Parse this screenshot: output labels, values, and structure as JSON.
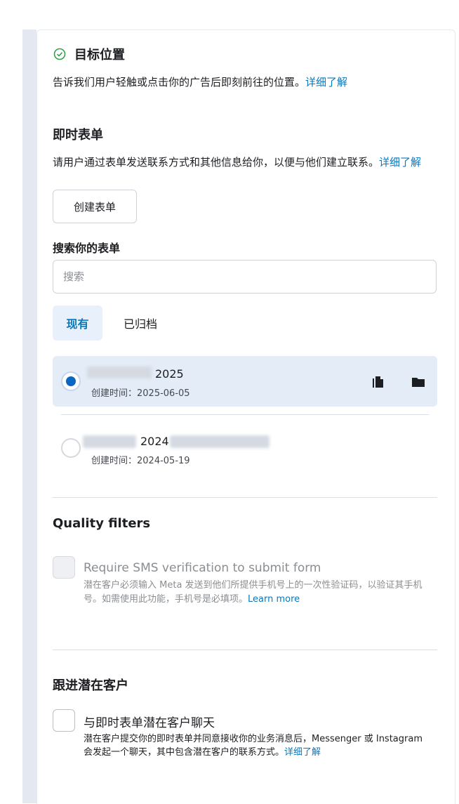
{
  "destination": {
    "title": "目标位置",
    "description": "告诉我们用户轻触或点击你的广告后即刻前往的位置。",
    "learn_more": "详细了解"
  },
  "instant_form": {
    "title": "即时表单",
    "description": "请用户通过表单发送联系方式和其他信息给你，以便与他们建立联系。",
    "learn_more": "详细了解",
    "create_button": "创建表单",
    "search_label": "搜索你的表单",
    "search_placeholder": "搜索",
    "tabs": [
      {
        "label": "现有",
        "active": true
      },
      {
        "label": "已归档",
        "active": false
      }
    ],
    "forms": [
      {
        "name_visible": "2025",
        "created": "创建时间：2025-06-05",
        "selected": true
      },
      {
        "name_visible": "2024",
        "created": "创建时间：2024-05-19",
        "selected": false
      }
    ]
  },
  "quality_filters": {
    "title": "Quality filters",
    "option_title": "Require SMS verification to submit form",
    "option_desc": "潜在客户必须输入 Meta 发送到他们所提供手机号上的一次性验证码，以验证其手机号。如需使用此功能，手机号是必填项。",
    "learn_more": "Learn more"
  },
  "follow_up": {
    "title": "跟进潜在客户",
    "option_title": "与即时表单潜在客户聊天",
    "option_desc": "潜在客户提交你的即时表单并同意接收你的业务消息后，Messenger 或 Instagram 会发起一个聊天，其中包含潜在客户的联系方式。",
    "learn_more": "详细了解"
  },
  "colors": {
    "accent": "#0a66c2",
    "link": "#0a78be",
    "selected_row": "#e4ecf7"
  }
}
